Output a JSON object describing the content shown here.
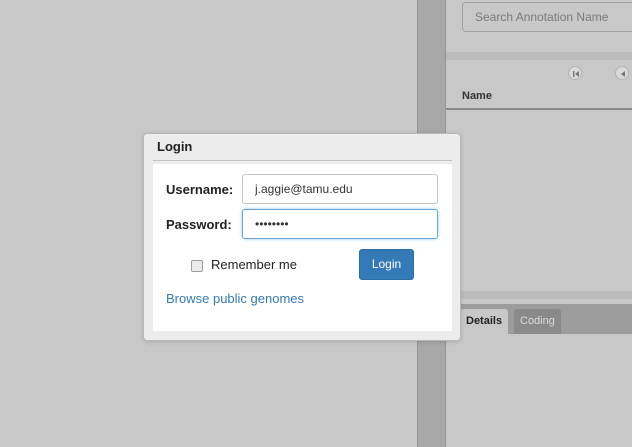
{
  "search": {
    "placeholder": "Search Annotation Name"
  },
  "table": {
    "header": "Name"
  },
  "tabs": [
    {
      "label": "Details"
    },
    {
      "label": "Coding"
    }
  ],
  "login": {
    "title": "Login",
    "username_label": "Username:",
    "username_value": "j.aggie@tamu.edu",
    "password_label": "Password:",
    "password_value": "••••••••",
    "remember_label": "Remember me",
    "button_label": "Login",
    "browse_link": "Browse public genomes"
  },
  "colors": {
    "background": "#c8c8c8",
    "accent": "#337ab7",
    "dialog_bg": "#ececec",
    "dialog_body": "#ffffff"
  },
  "icons": {
    "pager_first": "first-page-icon",
    "pager_prev": "previous-page-icon"
  }
}
